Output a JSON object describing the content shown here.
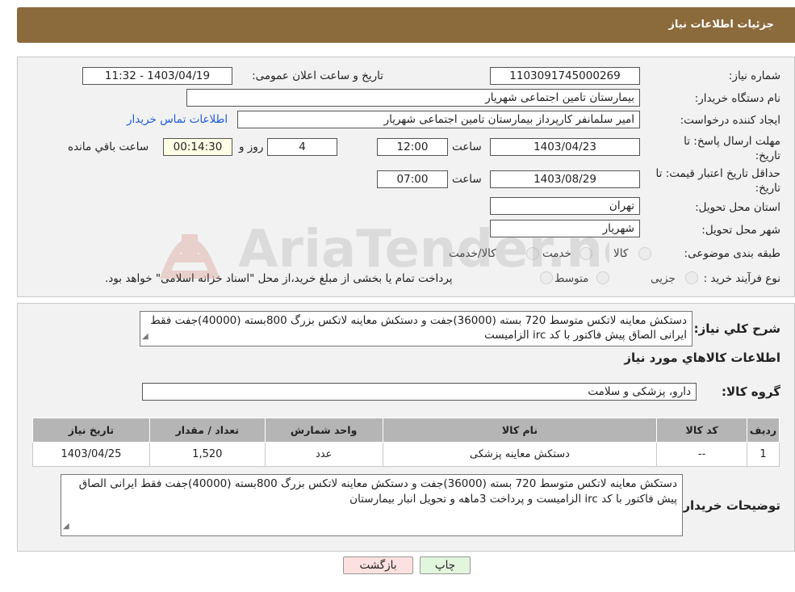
{
  "header": {
    "title": "جزئیات اطلاعات نیاز"
  },
  "form": {
    "need_number_label": "شماره نیاز:",
    "need_number": "1103091745000269",
    "announce_datetime_label": "تاریخ و ساعت اعلان عمومی:",
    "announce_datetime": "1403/04/19 - 11:32",
    "buyer_org_label": "نام دستگاه خریدار:",
    "buyer_org": "بیمارستان تامین اجتماعی شهریار",
    "requester_label": "ایجاد کننده درخواست:",
    "requester": "امیر سلمانفر کارپرداز بیمارستان تامین اجتماعی شهریار",
    "contact_link": "اطلاعات تماس خریدار",
    "reply_deadline_label": "مهلت ارسال پاسخ: تا تاریخ:",
    "reply_date": "1403/04/23",
    "time_label": "ساعت",
    "reply_time": "12:00",
    "days_value": "4",
    "day_label": "روز و",
    "remaining_time": "00:14:30",
    "remaining_label": "ساعت باقي مانده",
    "price_validity_label": "حداقل تاریخ اعتبار قیمت: تا تاریخ:",
    "validity_date": "1403/08/29",
    "validity_time": "07:00",
    "province_label": "استان محل تحویل:",
    "province": "تهران",
    "city_label": "شهر محل تحویل:",
    "city": "شهریار",
    "category_label": "طبقه بندی موضوعی:",
    "category_options": [
      "کالا",
      "خدمت",
      "کالا/خدمت"
    ],
    "process_label": "نوع فرآیند خرید :",
    "process_options": [
      "جزیی",
      "متوسط"
    ],
    "process_note": "پرداخت تمام یا بخشی از مبلغ خرید،از محل \"اسناد خزانه اسلامی\" خواهد بود."
  },
  "details": {
    "summary_label": "شرح كلي نياز:",
    "summary": "دستکش معاینه لاتکس متوسط 720 بسته (36000)جفت و دستکش معاینه لاتکس بزرگ 800بسته (40000)جفت فقط ایرانی الصاق پیش فاکتور با کد irc الزامیست",
    "items_title": "اطلاعات كالاهاي مورد نياز",
    "group_label": "گروه كالا:",
    "group": "دارو، پزشکی و سلامت",
    "table": {
      "headers": [
        "رديف",
        "كد كالا",
        "نام كالا",
        "واحد شمارش",
        "تعداد / مقدار",
        "تاريخ نياز"
      ],
      "rows": [
        [
          "1",
          "--",
          "دستکش معاینه پزشکی",
          "عدد",
          "1,520",
          "1403/04/25"
        ]
      ]
    },
    "buyer_notes_label": "توضیحات خریدار:",
    "buyer_notes": "دستکش معاینه لاتکس متوسط 720 بسته (36000)جفت و دستکش معاینه لاتکس بزرگ 800بسته (40000)جفت فقط ایرانی الصاق پیش فاکتور با کد irc الزامیست و پرداخت 3ماهه و تحویل انبار بیمارستان"
  },
  "buttons": {
    "print": "چاپ",
    "back": "بازگشت"
  },
  "watermark": {
    "text": "AriaTender.neT"
  },
  "colors": {
    "header": "#8b6a3b",
    "link": "#1d5bd8",
    "back_button": "#fde0e0",
    "print_button": "#e2f5dd"
  }
}
